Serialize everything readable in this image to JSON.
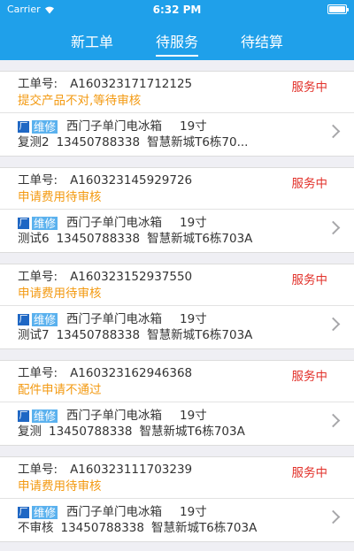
{
  "status_bar": {
    "carrier": "Carrier",
    "time": "6:32 PM"
  },
  "tabs": [
    {
      "label": "新工单",
      "active": false
    },
    {
      "label": "待服务",
      "active": true
    },
    {
      "label": "待结算",
      "active": false
    }
  ],
  "order_label": "工单号:",
  "tag_label": "维修",
  "factory_glyph": "厂",
  "orders": [
    {
      "order_no": "A160323171712125",
      "status": "服务中",
      "note": "提交产品不对,等待审核",
      "product": "西门子单门电冰箱",
      "size": "19寸",
      "customer": "复测2",
      "phone": "13450788338",
      "address": "智慧新城T6栋70..."
    },
    {
      "order_no": "A160323145929726",
      "status": "服务中",
      "note": "申请费用待审核",
      "product": "西门子单门电冰箱",
      "size": "19寸",
      "customer": "测试6",
      "phone": "13450788338",
      "address": "智慧新城T6栋703A"
    },
    {
      "order_no": "A160323152937550",
      "status": "服务中",
      "note": "申请费用待审核",
      "product": "西门子单门电冰箱",
      "size": "19寸",
      "customer": "测试7",
      "phone": "13450788338",
      "address": "智慧新城T6栋703A"
    },
    {
      "order_no": "A160323162946368",
      "status": "服务中",
      "note": "配件申请不通过",
      "product": "西门子单门电冰箱",
      "size": "19寸",
      "customer": "复测",
      "phone": "13450788338",
      "address": "智慧新城T6栋703A"
    },
    {
      "order_no": "A160323111703239",
      "status": "服务中",
      "note": "申请费用待审核",
      "product": "西门子单门电冰箱",
      "size": "19寸",
      "customer": "不审核",
      "phone": "13450788338",
      "address": "智慧新城T6栋703A"
    }
  ],
  "colors": {
    "header": "#1fa0ea",
    "status": "#e2322b",
    "note": "#f39a12",
    "tag": "#5ab1ee",
    "factory_icon": "#1f67c4"
  }
}
